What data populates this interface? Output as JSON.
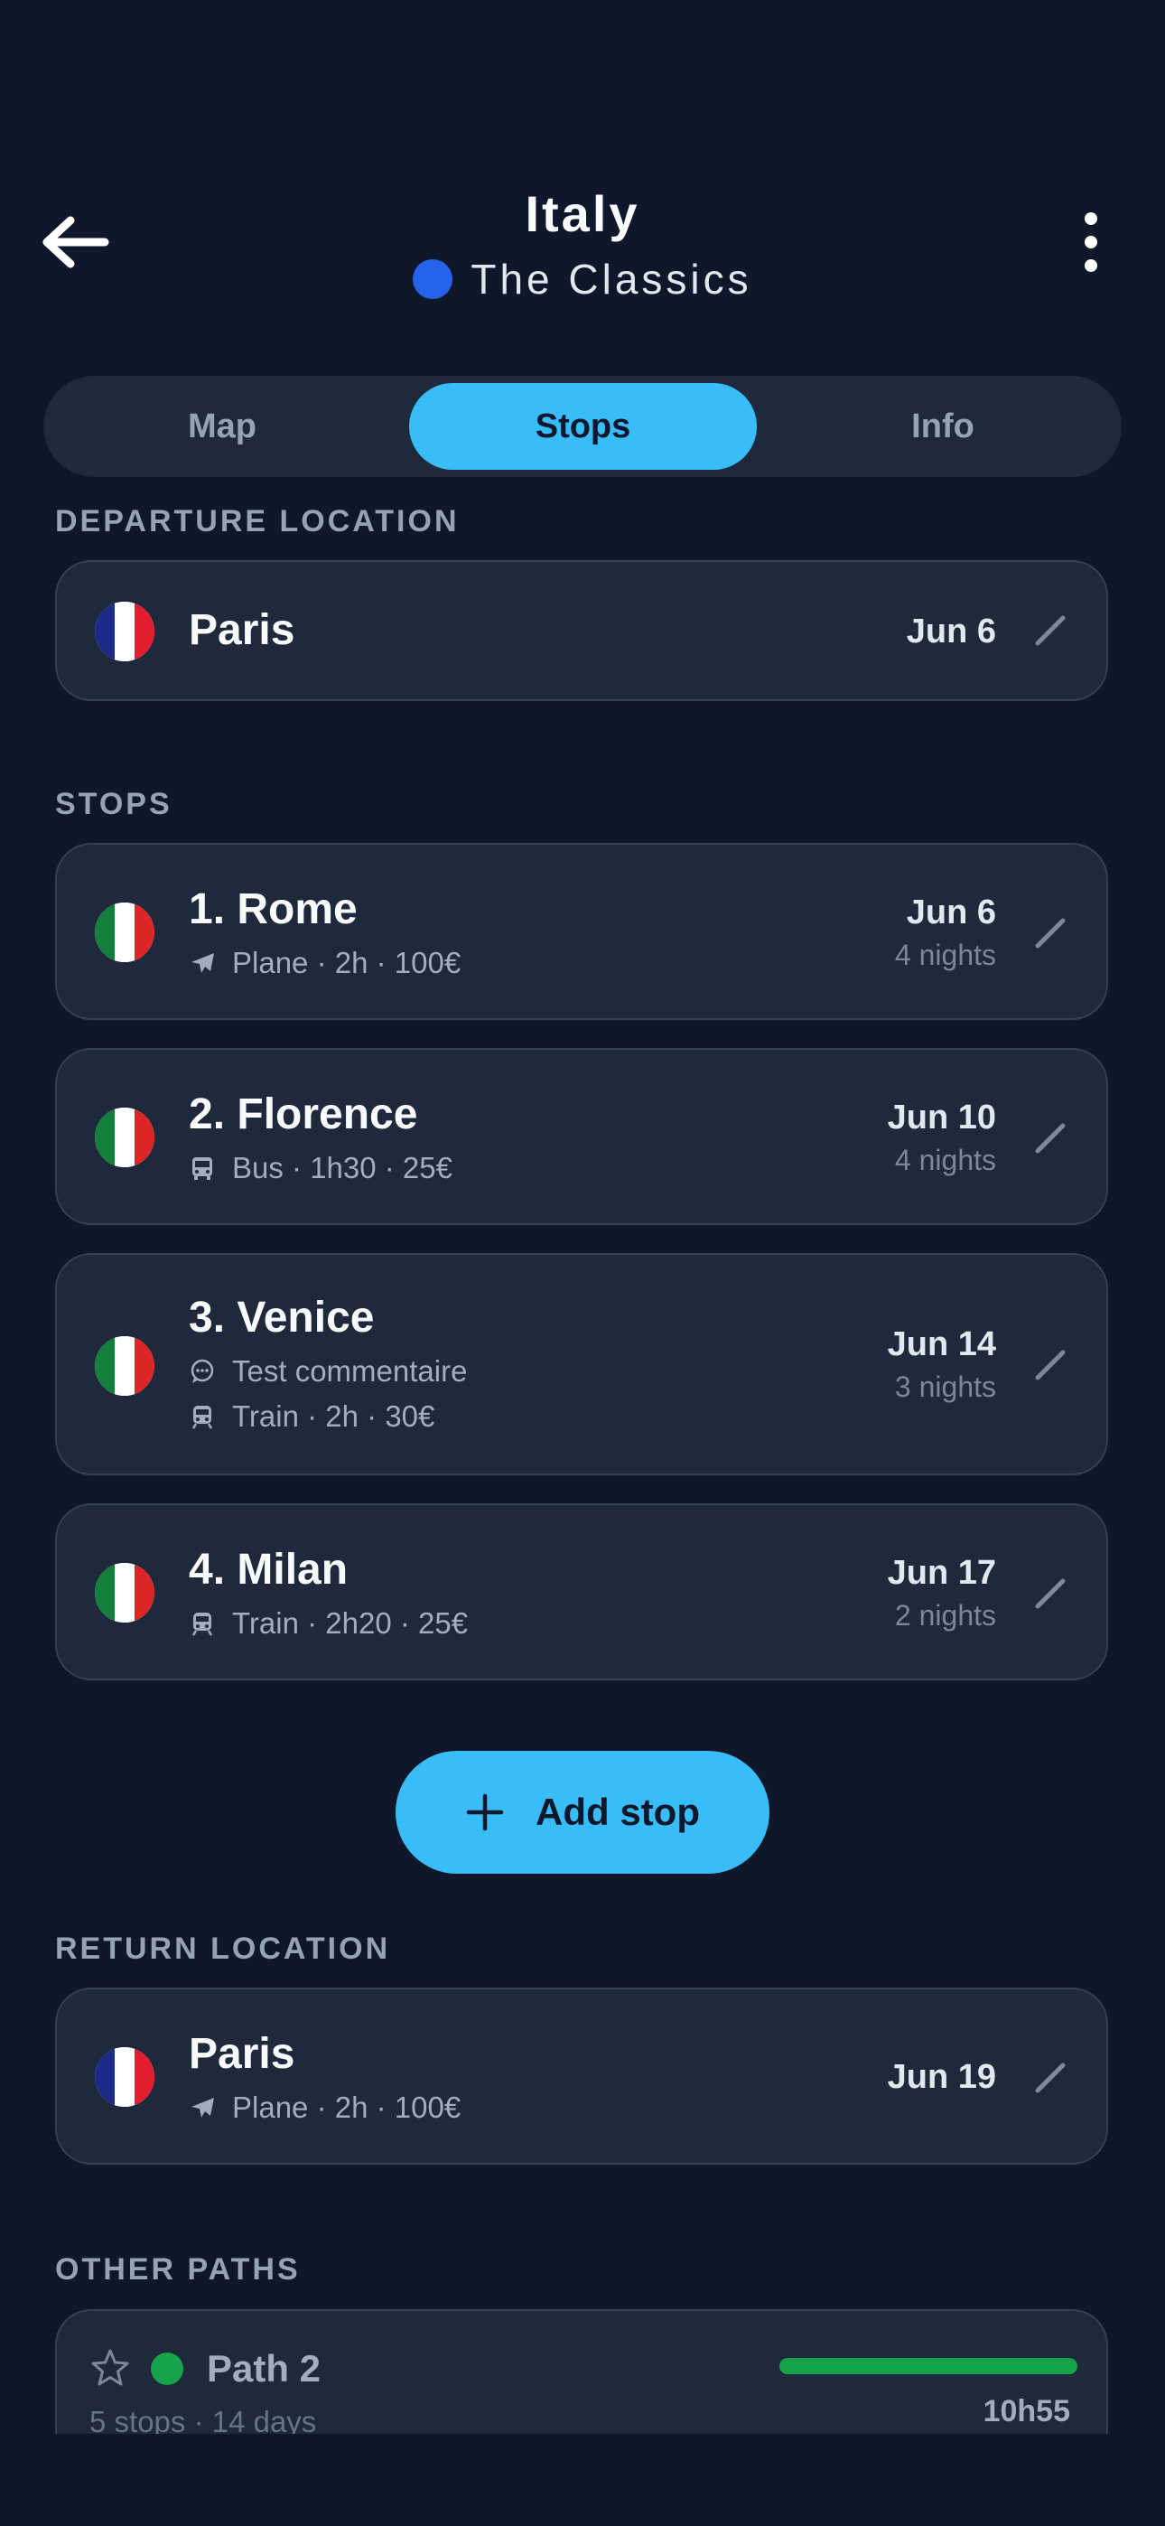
{
  "header": {
    "title": "Italy",
    "subtitle": "The Classics",
    "subtitle_dot_color": "#2563eb",
    "back_icon": "arrow-left-icon",
    "more_icon": "more-vertical-icon"
  },
  "tabs": [
    {
      "label": "Map",
      "active": false
    },
    {
      "label": "Stops",
      "active": true
    },
    {
      "label": "Info",
      "active": false
    }
  ],
  "departure": {
    "section_label": "DEPARTURE LOCATION",
    "flag": "france-flag",
    "city": "Paris",
    "date": "Jun 6"
  },
  "stops": {
    "section_label": "STOPS",
    "items": [
      {
        "flag": "italy-flag",
        "title": "1. Rome",
        "transport_icon": "plane-icon",
        "transport": "Plane · 2h · 100€",
        "date": "Jun 6",
        "nights": "4 nights"
      },
      {
        "flag": "italy-flag",
        "title": "2. Florence",
        "transport_icon": "bus-icon",
        "transport": "Bus · 1h30 · 25€",
        "date": "Jun 10",
        "nights": "4 nights"
      },
      {
        "flag": "italy-flag",
        "title": "3. Venice",
        "comment_icon": "comment-icon",
        "comment": "Test commentaire",
        "transport_icon": "train-icon",
        "transport": "Train · 2h · 30€",
        "date": "Jun 14",
        "nights": "3 nights"
      },
      {
        "flag": "italy-flag",
        "title": "4. Milan",
        "transport_icon": "train-icon",
        "transport": "Train · 2h20 · 25€",
        "date": "Jun 17",
        "nights": "2 nights"
      }
    ]
  },
  "add_stop": {
    "label": "Add stop",
    "icon": "plus-icon"
  },
  "return": {
    "section_label": "RETURN LOCATION",
    "flag": "france-flag",
    "city": "Paris",
    "transport_icon": "plane-icon",
    "transport": "Plane · 2h · 100€",
    "date": "Jun 19"
  },
  "other_paths": {
    "section_label": "OTHER PATHS",
    "items": [
      {
        "name": "Path 2",
        "dot_color": "#16a34a",
        "summary": "5 stops · 14 days",
        "duration": "10h55",
        "bar_color": "#16a34a",
        "bar_fill": 1.0
      }
    ]
  },
  "colors": {
    "background": "#0f172a",
    "card": "#1e293b",
    "accent": "#38bdf8"
  }
}
